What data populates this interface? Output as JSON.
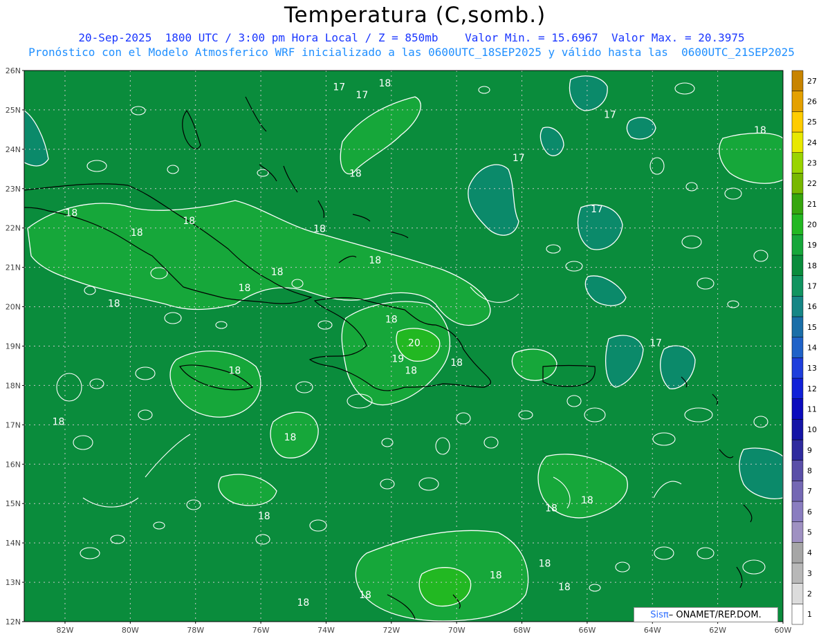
{
  "title": "Temperatura (C,somb.)",
  "subtitle_line1": "20-Sep-2025  1800 UTC / 3:00 pm Hora Local / Z = 850mb    Valor Min. = 15.6967  Valor Max. = 20.3975",
  "subtitle_line2": "Pronóstico con el Modelo Atmosferico WRF inicializado a las 0600UTC_18SEP2025 y válido hasta las  0600UTC_21SEP2025",
  "credit": {
    "logo": "Sisπ",
    "text": "– ONAMET/REP.DOM."
  },
  "map": {
    "lat_labels": [
      "26N",
      "25N",
      "24N",
      "23N",
      "22N",
      "21N",
      "20N",
      "19N",
      "18N",
      "17N",
      "16N",
      "15N",
      "14N",
      "13N",
      "12N"
    ],
    "lon_labels": [
      "82W",
      "80W",
      "78W",
      "76W",
      "74W",
      "72W",
      "70W",
      "68W",
      "66W",
      "64W",
      "62W",
      "60W"
    ],
    "contour_labels": [
      {
        "text": "18",
        "lon": -72.2,
        "lat": 25.6
      },
      {
        "text": "17",
        "lon": -73.6,
        "lat": 25.5
      },
      {
        "text": "17",
        "lon": -72.9,
        "lat": 25.3
      },
      {
        "text": "17",
        "lon": -65.3,
        "lat": 24.8
      },
      {
        "text": "18",
        "lon": -60.7,
        "lat": 24.4
      },
      {
        "text": "17",
        "lon": -68.1,
        "lat": 23.7
      },
      {
        "text": "18",
        "lon": -73.1,
        "lat": 23.3
      },
      {
        "text": "18",
        "lon": -81.8,
        "lat": 22.3
      },
      {
        "text": "18",
        "lon": -78.2,
        "lat": 22.1
      },
      {
        "text": "18",
        "lon": -74.2,
        "lat": 21.9
      },
      {
        "text": "17",
        "lon": -65.7,
        "lat": 22.4
      },
      {
        "text": "18",
        "lon": -79.8,
        "lat": 21.8
      },
      {
        "text": "18",
        "lon": -72.5,
        "lat": 21.1
      },
      {
        "text": "18",
        "lon": -75.5,
        "lat": 20.8
      },
      {
        "text": "18",
        "lon": -76.5,
        "lat": 20.4
      },
      {
        "text": "18",
        "lon": -80.5,
        "lat": 20.0
      },
      {
        "text": "18",
        "lon": -72.0,
        "lat": 19.6
      },
      {
        "text": "20",
        "lon": -71.3,
        "lat": 19.0
      },
      {
        "text": "19",
        "lon": -71.8,
        "lat": 18.6
      },
      {
        "text": "18",
        "lon": -71.4,
        "lat": 18.3
      },
      {
        "text": "18",
        "lon": -70.0,
        "lat": 18.5
      },
      {
        "text": "18",
        "lon": -76.8,
        "lat": 18.3
      },
      {
        "text": "17",
        "lon": -63.9,
        "lat": 19.0
      },
      {
        "text": "18",
        "lon": -82.2,
        "lat": 17.0
      },
      {
        "text": "18",
        "lon": -75.1,
        "lat": 16.6
      },
      {
        "text": "18",
        "lon": -66.0,
        "lat": 15.0
      },
      {
        "text": "18",
        "lon": -67.1,
        "lat": 14.8
      },
      {
        "text": "18",
        "lon": -75.9,
        "lat": 14.6
      },
      {
        "text": "18",
        "lon": -67.3,
        "lat": 13.4
      },
      {
        "text": "18",
        "lon": -68.8,
        "lat": 13.1
      },
      {
        "text": "18",
        "lon": -66.7,
        "lat": 12.8
      },
      {
        "text": "18",
        "lon": -72.8,
        "lat": 12.6
      },
      {
        "text": "18",
        "lon": -74.7,
        "lat": 12.4
      }
    ],
    "colors": {
      "field_18": "#0a8c3c",
      "field_19": "#16a73a",
      "field_17": "#0b8a6a",
      "field_16": "#138a7e"
    }
  },
  "colorbar": {
    "labels": [
      "1",
      "2",
      "3",
      "4",
      "5",
      "6",
      "7",
      "8",
      "9",
      "10",
      "11",
      "12",
      "13",
      "14",
      "15",
      "16",
      "17",
      "18",
      "19",
      "20",
      "21",
      "22",
      "23",
      "24",
      "25",
      "26",
      "27"
    ],
    "colors": [
      "#ffffff",
      "#dcdcdc",
      "#b8b8b8",
      "#a6a6a6",
      "#9f91c2",
      "#8a7dc0",
      "#7468b4",
      "#5a4fa8",
      "#2e2a9e",
      "#1414a6",
      "#0b0bbd",
      "#1020d8",
      "#1e3edc",
      "#1f62c8",
      "#1a6ea8",
      "#168686",
      "#119460",
      "#0a8c3c",
      "#16a73a",
      "#22b822",
      "#36a60e",
      "#78b800",
      "#9ad400",
      "#e8e800",
      "#ffcc00",
      "#e4a000",
      "#c88400"
    ]
  }
}
